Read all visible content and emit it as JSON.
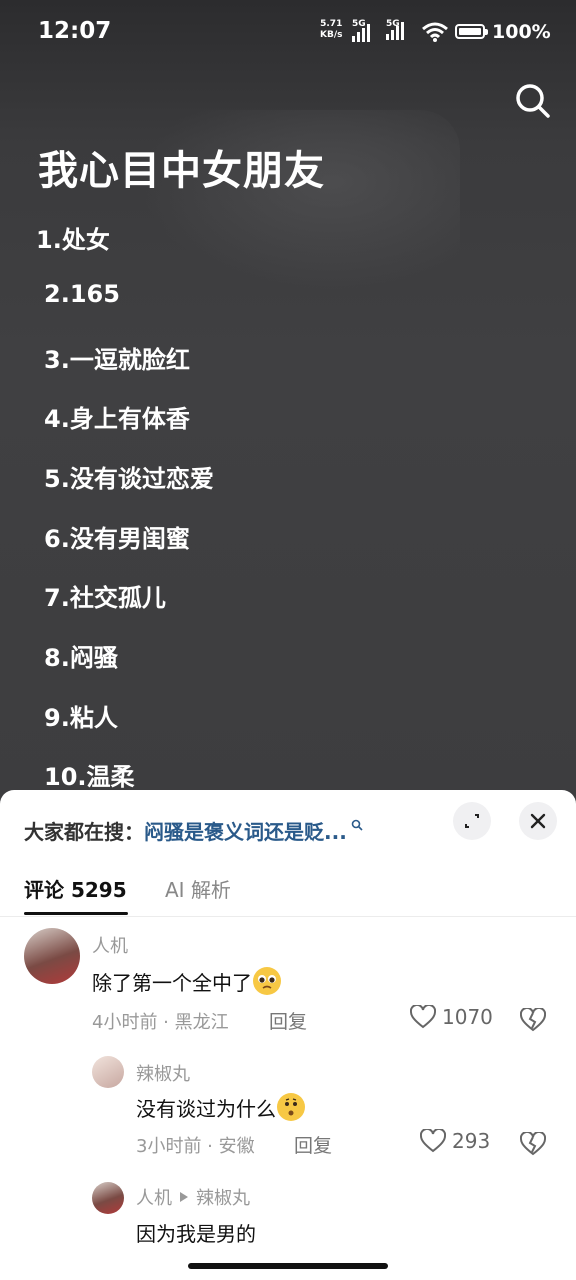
{
  "status_bar": {
    "time": "12:07",
    "net_speed": "5.71",
    "net_unit": "KB/s",
    "sim1": "5G",
    "sim2": "5G",
    "battery": "100%"
  },
  "post": {
    "title": "我心目中女朋友",
    "items": [
      "1.处女",
      "2.165",
      "3.一逗就脸红",
      "4.身上有体香",
      "5.没有谈过恋爱",
      "6.没有男闺蜜",
      "7.社交孤儿",
      "8.闷骚",
      "9.粘人",
      "10.温柔"
    ]
  },
  "sheet": {
    "search_prefix": "大家都在搜：",
    "search_keyword": "闷骚是褒义词还是贬...",
    "tabs": [
      {
        "label": "评论 5295"
      },
      {
        "label": "AI 解析"
      }
    ],
    "comments": [
      {
        "user": "人机",
        "text": "除了第一个全中了",
        "emoji": "pleading-face",
        "meta": "4小时前 · 黑龙江",
        "reply": "回复",
        "likes": "1070"
      },
      {
        "user": "辣椒丸",
        "text": "没有谈过为什么",
        "emoji": "thinking-face",
        "meta": "3小时前 · 安徽",
        "reply": "回复",
        "likes": "293"
      },
      {
        "user": "人机",
        "reply_to": "辣椒丸",
        "text": "因为我是男的"
      }
    ]
  },
  "colors": {
    "background_dark": "#3a3a3c",
    "keyword_blue": "#2a5a8a",
    "sheet": "#ffffff"
  }
}
